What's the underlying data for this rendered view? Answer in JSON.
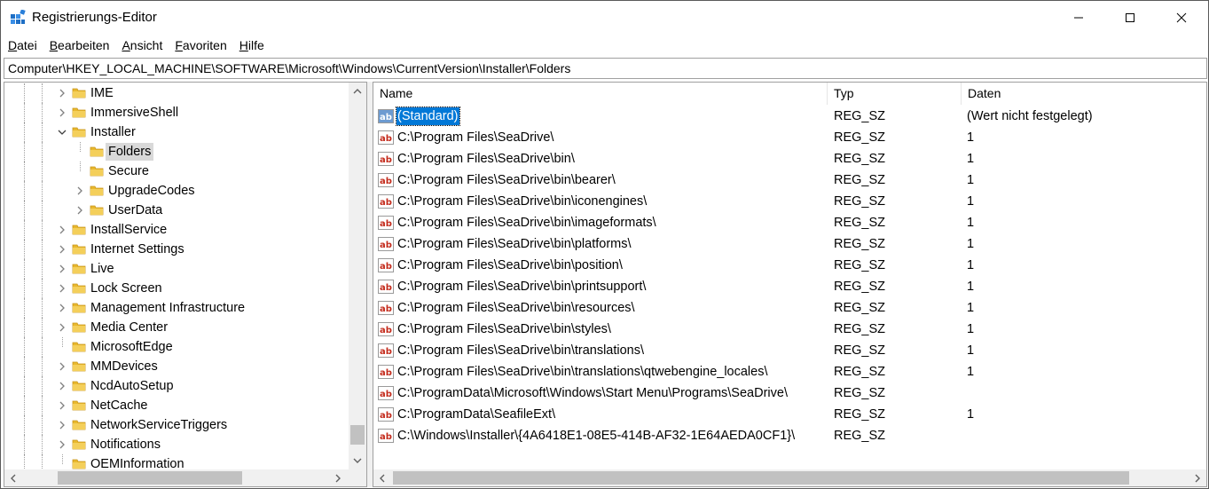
{
  "window": {
    "title": "Registrierungs-Editor"
  },
  "menu": {
    "items": [
      {
        "label_accel": "D",
        "label_rest": "atei"
      },
      {
        "label_accel": "B",
        "label_rest": "earbeiten"
      },
      {
        "label_accel": "A",
        "label_rest": "nsicht"
      },
      {
        "label_accel": "F",
        "label_rest": "avoriten"
      },
      {
        "label_accel": "H",
        "label_rest": "ilfe"
      }
    ]
  },
  "address": {
    "path": "Computer\\HKEY_LOCAL_MACHINE\\SOFTWARE\\Microsoft\\Windows\\CurrentVersion\\Installer\\Folders"
  },
  "tree": {
    "items": [
      {
        "label": "IME",
        "expander": "collapsed",
        "depth": 0
      },
      {
        "label": "ImmersiveShell",
        "expander": "collapsed",
        "depth": 0
      },
      {
        "label": "Installer",
        "expander": "expanded",
        "depth": 0
      },
      {
        "label": "Folders",
        "expander": "none",
        "depth": 1,
        "selected": true
      },
      {
        "label": "Secure",
        "expander": "none",
        "depth": 1
      },
      {
        "label": "UpgradeCodes",
        "expander": "collapsed",
        "depth": 1
      },
      {
        "label": "UserData",
        "expander": "collapsed",
        "depth": 1
      },
      {
        "label": "InstallService",
        "expander": "collapsed",
        "depth": 0
      },
      {
        "label": "Internet Settings",
        "expander": "collapsed",
        "depth": 0
      },
      {
        "label": "Live",
        "expander": "collapsed",
        "depth": 0
      },
      {
        "label": "Lock Screen",
        "expander": "collapsed",
        "depth": 0
      },
      {
        "label": "Management Infrastructure",
        "expander": "collapsed",
        "depth": 0
      },
      {
        "label": "Media Center",
        "expander": "collapsed",
        "depth": 0
      },
      {
        "label": "MicrosoftEdge",
        "expander": "none",
        "depth": 0
      },
      {
        "label": "MMDevices",
        "expander": "collapsed",
        "depth": 0
      },
      {
        "label": "NcdAutoSetup",
        "expander": "collapsed",
        "depth": 0
      },
      {
        "label": "NetCache",
        "expander": "collapsed",
        "depth": 0
      },
      {
        "label": "NetworkServiceTriggers",
        "expander": "collapsed",
        "depth": 0
      },
      {
        "label": "Notifications",
        "expander": "collapsed",
        "depth": 0
      },
      {
        "label": "OEMInformation",
        "expander": "none",
        "depth": 0
      }
    ]
  },
  "list": {
    "columns": {
      "name": "Name",
      "type": "Typ",
      "data": "Daten"
    },
    "rows": [
      {
        "name": "(Standard)",
        "type": "REG_SZ",
        "data": "(Wert nicht festgelegt)",
        "selected": true
      },
      {
        "name": "C:\\Program Files\\SeaDrive\\",
        "type": "REG_SZ",
        "data": "1"
      },
      {
        "name": "C:\\Program Files\\SeaDrive\\bin\\",
        "type": "REG_SZ",
        "data": "1"
      },
      {
        "name": "C:\\Program Files\\SeaDrive\\bin\\bearer\\",
        "type": "REG_SZ",
        "data": "1"
      },
      {
        "name": "C:\\Program Files\\SeaDrive\\bin\\iconengines\\",
        "type": "REG_SZ",
        "data": "1"
      },
      {
        "name": "C:\\Program Files\\SeaDrive\\bin\\imageformats\\",
        "type": "REG_SZ",
        "data": "1"
      },
      {
        "name": "C:\\Program Files\\SeaDrive\\bin\\platforms\\",
        "type": "REG_SZ",
        "data": "1"
      },
      {
        "name": "C:\\Program Files\\SeaDrive\\bin\\position\\",
        "type": "REG_SZ",
        "data": "1"
      },
      {
        "name": "C:\\Program Files\\SeaDrive\\bin\\printsupport\\",
        "type": "REG_SZ",
        "data": "1"
      },
      {
        "name": "C:\\Program Files\\SeaDrive\\bin\\resources\\",
        "type": "REG_SZ",
        "data": "1"
      },
      {
        "name": "C:\\Program Files\\SeaDrive\\bin\\styles\\",
        "type": "REG_SZ",
        "data": "1"
      },
      {
        "name": "C:\\Program Files\\SeaDrive\\bin\\translations\\",
        "type": "REG_SZ",
        "data": "1"
      },
      {
        "name": "C:\\Program Files\\SeaDrive\\bin\\translations\\qtwebengine_locales\\",
        "type": "REG_SZ",
        "data": "1"
      },
      {
        "name": "C:\\ProgramData\\Microsoft\\Windows\\Start Menu\\Programs\\SeaDrive\\",
        "type": "REG_SZ",
        "data": ""
      },
      {
        "name": "C:\\ProgramData\\SeafileExt\\",
        "type": "REG_SZ",
        "data": "1"
      },
      {
        "name": "C:\\Windows\\Installer\\{4A6418E1-08E5-414B-AF32-1E64AEDA0CF1}\\",
        "type": "REG_SZ",
        "data": ""
      }
    ]
  },
  "colors": {
    "selection": "#0078d7",
    "tree_selection": "#d9d9d9",
    "folder": "#e8b82e",
    "string_icon": "#c42b1c"
  }
}
